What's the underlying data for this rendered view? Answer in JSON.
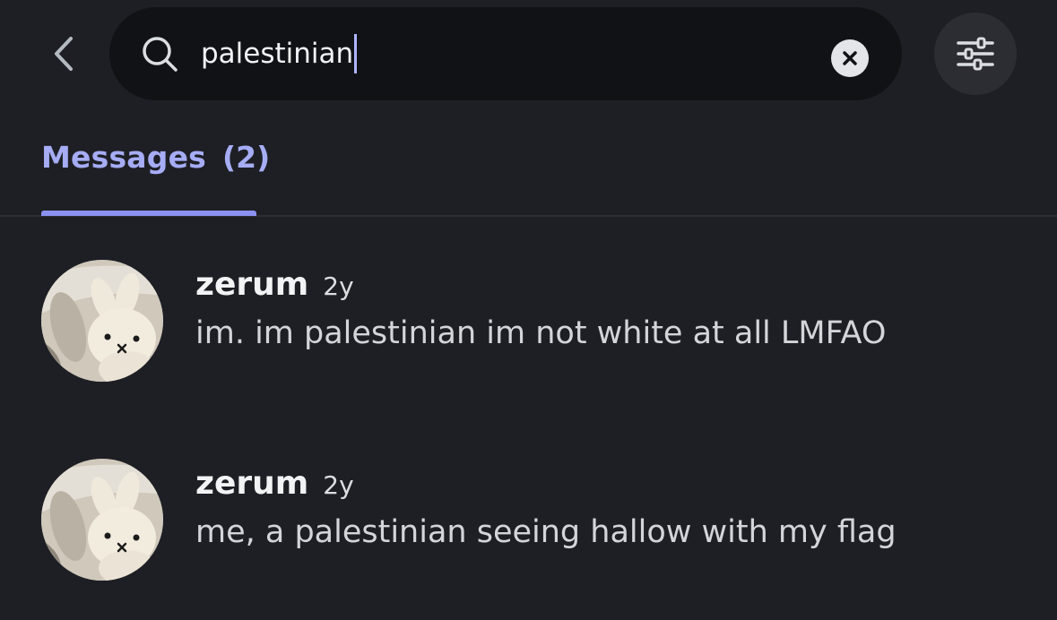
{
  "search": {
    "query": "palestinian"
  },
  "tabs": [
    {
      "label": "Messages",
      "count": "(2)"
    }
  ],
  "results": [
    {
      "username": "zerum",
      "time": "2y",
      "message": "im. im palestinian im not white at all LMFAO"
    },
    {
      "username": "zerum",
      "time": "2y",
      "message": "me, a palestinian seeing hallow with my flag"
    }
  ],
  "icons": {
    "back": "chevron-left-icon",
    "search": "search-icon",
    "clear": "close-circle-icon",
    "filter": "sliders-icon"
  },
  "colors": {
    "background": "#1e1f25",
    "search_field": "#111216",
    "accent": "#8c92f2",
    "accent_text": "#a6adf5"
  }
}
